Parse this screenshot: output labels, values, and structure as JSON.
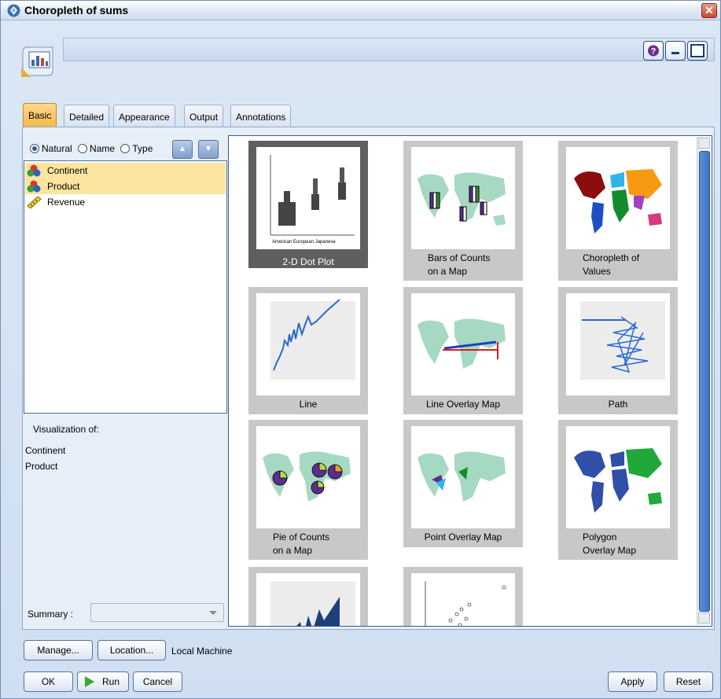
{
  "window": {
    "title": "Choropleth of sums"
  },
  "tabs": [
    {
      "label": "Basic",
      "active": true
    },
    {
      "label": "Detailed"
    },
    {
      "label": "Appearance"
    },
    {
      "label": "Output"
    },
    {
      "label": "Annotations"
    }
  ],
  "sort_options": [
    {
      "label": "Natural",
      "selected": true
    },
    {
      "label": "Name",
      "selected": false
    },
    {
      "label": "Type",
      "selected": false
    }
  ],
  "fields": [
    {
      "label": "Continent",
      "icon": "nominal-icon",
      "selected": true
    },
    {
      "label": "Product",
      "icon": "nominal-icon",
      "selected": true
    },
    {
      "label": "Revenue",
      "icon": "continuous-icon",
      "selected": false
    }
  ],
  "visualization": {
    "label": "Visualization of:",
    "fields": [
      "Continent",
      "Product"
    ]
  },
  "summary": {
    "label": "Summary :",
    "value": ""
  },
  "gallery": [
    {
      "label": "2-D Dot Plot",
      "selected": true,
      "thumb": "dotplot"
    },
    {
      "label": "Bars of Counts\non a Map",
      "selected": false,
      "thumb": "map-bars"
    },
    {
      "label": "Choropleth of\nValues",
      "selected": false,
      "thumb": "map-choropleth"
    },
    {
      "label": "Line",
      "selected": false,
      "thumb": "line"
    },
    {
      "label": "Line Overlay Map",
      "selected": false,
      "thumb": "map-line"
    },
    {
      "label": "Path",
      "selected": false,
      "thumb": "path"
    },
    {
      "label": "Pie of Counts\non a Map",
      "selected": false,
      "thumb": "map-pie"
    },
    {
      "label": "Point Overlay Map",
      "selected": false,
      "thumb": "map-point"
    },
    {
      "label": "Polygon\nOverlay Map",
      "selected": false,
      "thumb": "map-polygon"
    },
    {
      "label": "",
      "selected": false,
      "thumb": "area"
    },
    {
      "label": "",
      "selected": false,
      "thumb": "scatter"
    }
  ],
  "footer": {
    "manage": "Manage...",
    "location": "Location...",
    "location_value": "Local Machine",
    "ok": "OK",
    "run": "Run",
    "cancel": "Cancel",
    "apply": "Apply",
    "reset": "Reset"
  }
}
